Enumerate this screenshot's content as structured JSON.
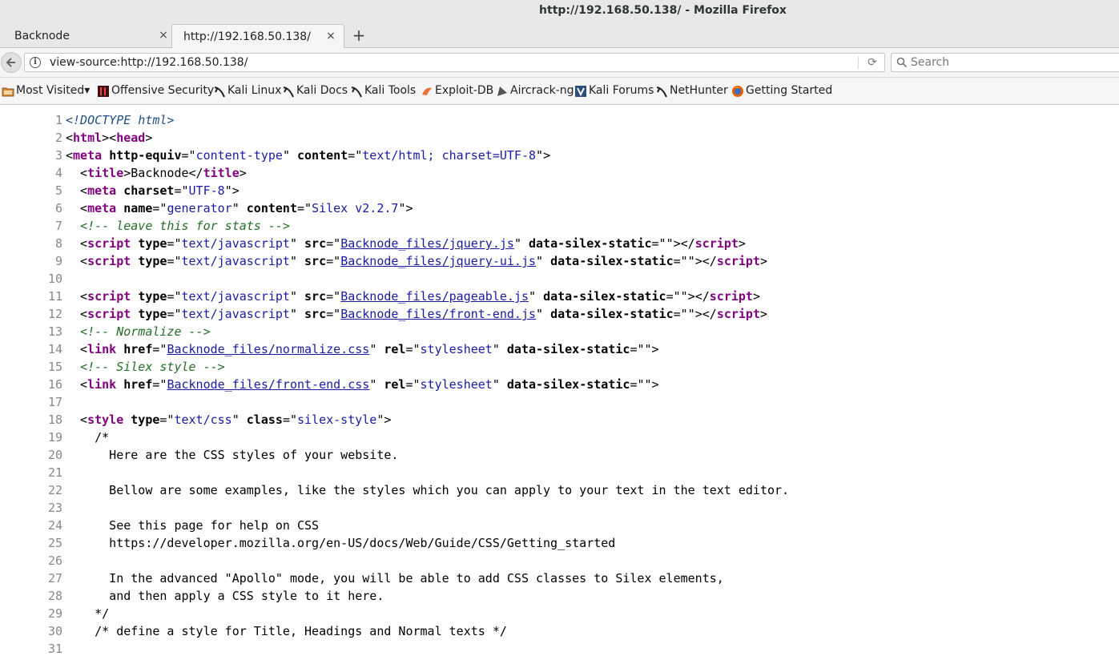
{
  "window": {
    "title": "http://192.168.50.138/ - Mozilla Firefox"
  },
  "tabs": [
    {
      "label": "Backnode",
      "close": "×"
    },
    {
      "label": "http://192.168.50.138/",
      "close": "×"
    }
  ],
  "new_tab_symbol": "+",
  "navbar": {
    "url": "view-source:http://192.168.50.138/",
    "search_placeholder": "Search"
  },
  "bookmarks": [
    {
      "label": "Most Visited▾",
      "icon": "folder-icon"
    },
    {
      "label": "Offensive Security",
      "icon": "offsec-icon"
    },
    {
      "label": "Kali Linux",
      "icon": "kali-dragon-icon"
    },
    {
      "label": "Kali Docs",
      "icon": "kali-dragon-icon"
    },
    {
      "label": "Kali Tools",
      "icon": "kali-dragon-icon"
    },
    {
      "label": "Exploit-DB",
      "icon": "exploitdb-icon"
    },
    {
      "label": "Aircrack-ng",
      "icon": "aircrack-icon"
    },
    {
      "label": "Kali Forums",
      "icon": "kali-forums-icon"
    },
    {
      "label": "NetHunter",
      "icon": "kali-dragon-icon"
    },
    {
      "label": "Getting Started",
      "icon": "firefox-icon"
    }
  ],
  "source_lines": [
    [
      [
        "d",
        "<!DOCTYPE html>"
      ]
    ],
    [
      [
        "p",
        "<"
      ],
      [
        "t",
        "html"
      ],
      [
        "p",
        "><"
      ],
      [
        "t",
        "head"
      ],
      [
        "p",
        ">"
      ]
    ],
    [
      [
        "p",
        "<"
      ],
      [
        "t",
        "meta"
      ],
      [
        "p",
        " "
      ],
      [
        "a",
        "http-equiv"
      ],
      [
        "p",
        "=\""
      ],
      [
        "v",
        "content-type"
      ],
      [
        "p",
        "\" "
      ],
      [
        "a",
        "content"
      ],
      [
        "p",
        "=\""
      ],
      [
        "v",
        "text/html; charset=UTF-8"
      ],
      [
        "p",
        "\">"
      ]
    ],
    [
      [
        "p",
        "  <"
      ],
      [
        "t",
        "title"
      ],
      [
        "p",
        ">Backnode</"
      ],
      [
        "t",
        "title"
      ],
      [
        "p",
        ">"
      ]
    ],
    [
      [
        "p",
        "  <"
      ],
      [
        "t",
        "meta"
      ],
      [
        "p",
        " "
      ],
      [
        "a",
        "charset"
      ],
      [
        "p",
        "=\""
      ],
      [
        "v",
        "UTF-8"
      ],
      [
        "p",
        "\">"
      ]
    ],
    [
      [
        "p",
        "  <"
      ],
      [
        "t",
        "meta"
      ],
      [
        "p",
        " "
      ],
      [
        "a",
        "name"
      ],
      [
        "p",
        "=\""
      ],
      [
        "v",
        "generator"
      ],
      [
        "p",
        "\" "
      ],
      [
        "a",
        "content"
      ],
      [
        "p",
        "=\""
      ],
      [
        "v",
        "Silex v2.2.7"
      ],
      [
        "p",
        "\">"
      ]
    ],
    [
      [
        "p",
        "  "
      ],
      [
        "c",
        "<!-- leave this for stats -->"
      ]
    ],
    [
      [
        "p",
        "  <"
      ],
      [
        "t",
        "script"
      ],
      [
        "p",
        " "
      ],
      [
        "a",
        "type"
      ],
      [
        "p",
        "=\""
      ],
      [
        "v",
        "text/javascript"
      ],
      [
        "p",
        "\" "
      ],
      [
        "a",
        "src"
      ],
      [
        "p",
        "=\""
      ],
      [
        "l",
        "Backnode_files/jquery.js"
      ],
      [
        "p",
        "\" "
      ],
      [
        "a",
        "data-silex-static"
      ],
      [
        "p",
        "=\"\"></"
      ],
      [
        "t",
        "script"
      ],
      [
        "p",
        ">"
      ]
    ],
    [
      [
        "p",
        "  <"
      ],
      [
        "t",
        "script"
      ],
      [
        "p",
        " "
      ],
      [
        "a",
        "type"
      ],
      [
        "p",
        "=\""
      ],
      [
        "v",
        "text/javascript"
      ],
      [
        "p",
        "\" "
      ],
      [
        "a",
        "src"
      ],
      [
        "p",
        "=\""
      ],
      [
        "l",
        "Backnode_files/jquery-ui.js"
      ],
      [
        "p",
        "\" "
      ],
      [
        "a",
        "data-silex-static"
      ],
      [
        "p",
        "=\"\"></"
      ],
      [
        "t",
        "script"
      ],
      [
        "p",
        ">"
      ]
    ],
    [],
    [
      [
        "p",
        "  <"
      ],
      [
        "t",
        "script"
      ],
      [
        "p",
        " "
      ],
      [
        "a",
        "type"
      ],
      [
        "p",
        "=\""
      ],
      [
        "v",
        "text/javascript"
      ],
      [
        "p",
        "\" "
      ],
      [
        "a",
        "src"
      ],
      [
        "p",
        "=\""
      ],
      [
        "l",
        "Backnode_files/pageable.js"
      ],
      [
        "p",
        "\" "
      ],
      [
        "a",
        "data-silex-static"
      ],
      [
        "p",
        "=\"\"></"
      ],
      [
        "t",
        "script"
      ],
      [
        "p",
        ">"
      ]
    ],
    [
      [
        "p",
        "  <"
      ],
      [
        "t",
        "script"
      ],
      [
        "p",
        " "
      ],
      [
        "a",
        "type"
      ],
      [
        "p",
        "=\""
      ],
      [
        "v",
        "text/javascript"
      ],
      [
        "p",
        "\" "
      ],
      [
        "a",
        "src"
      ],
      [
        "p",
        "=\""
      ],
      [
        "l",
        "Backnode_files/front-end.js"
      ],
      [
        "p",
        "\" "
      ],
      [
        "a",
        "data-silex-static"
      ],
      [
        "p",
        "=\"\"></"
      ],
      [
        "t",
        "script"
      ],
      [
        "p",
        ">"
      ]
    ],
    [
      [
        "p",
        "  "
      ],
      [
        "c",
        "<!-- Normalize -->"
      ]
    ],
    [
      [
        "p",
        "  <"
      ],
      [
        "t",
        "link"
      ],
      [
        "p",
        " "
      ],
      [
        "a",
        "href"
      ],
      [
        "p",
        "=\""
      ],
      [
        "l",
        "Backnode_files/normalize.css"
      ],
      [
        "p",
        "\" "
      ],
      [
        "a",
        "rel"
      ],
      [
        "p",
        "=\""
      ],
      [
        "v",
        "stylesheet"
      ],
      [
        "p",
        "\" "
      ],
      [
        "a",
        "data-silex-static"
      ],
      [
        "p",
        "=\"\">"
      ]
    ],
    [
      [
        "p",
        "  "
      ],
      [
        "c",
        "<!-- Silex style -->"
      ]
    ],
    [
      [
        "p",
        "  <"
      ],
      [
        "t",
        "link"
      ],
      [
        "p",
        " "
      ],
      [
        "a",
        "href"
      ],
      [
        "p",
        "=\""
      ],
      [
        "l",
        "Backnode_files/front-end.css"
      ],
      [
        "p",
        "\" "
      ],
      [
        "a",
        "rel"
      ],
      [
        "p",
        "=\""
      ],
      [
        "v",
        "stylesheet"
      ],
      [
        "p",
        "\" "
      ],
      [
        "a",
        "data-silex-static"
      ],
      [
        "p",
        "=\"\">"
      ]
    ],
    [],
    [
      [
        "p",
        "  <"
      ],
      [
        "t",
        "style"
      ],
      [
        "p",
        " "
      ],
      [
        "a",
        "type"
      ],
      [
        "p",
        "=\""
      ],
      [
        "v",
        "text/css"
      ],
      [
        "p",
        "\" "
      ],
      [
        "a",
        "class"
      ],
      [
        "p",
        "=\""
      ],
      [
        "v",
        "silex-style"
      ],
      [
        "p",
        "\">"
      ]
    ],
    [
      [
        "p",
        "    /*"
      ]
    ],
    [
      [
        "p",
        "      Here are the CSS styles of your website."
      ]
    ],
    [],
    [
      [
        "p",
        "      Bellow are some examples, like the styles which you can apply to your text in the text editor."
      ]
    ],
    [],
    [
      [
        "p",
        "      See this page for help on CSS"
      ]
    ],
    [
      [
        "p",
        "      https://developer.mozilla.org/en-US/docs/Web/Guide/CSS/Getting_started"
      ]
    ],
    [],
    [
      [
        "p",
        "      In the advanced \"Apollo\" mode, you will be able to add CSS classes to Silex elements,"
      ]
    ],
    [
      [
        "p",
        "      and then apply a CSS style to it here."
      ]
    ],
    [
      [
        "p",
        "    */"
      ]
    ],
    [
      [
        "p",
        "    /* define a style for Title, Headings and Normal texts */"
      ]
    ],
    []
  ]
}
